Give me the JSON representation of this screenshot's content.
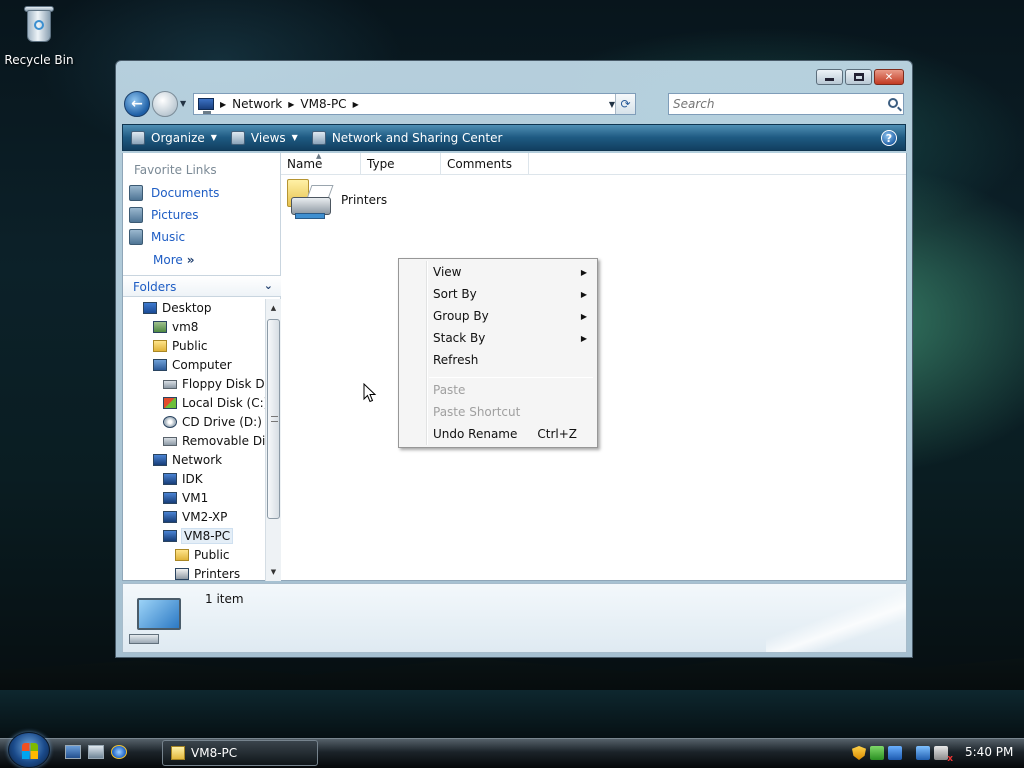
{
  "desktop": {
    "recycle_bin_label": "Recycle Bin"
  },
  "window": {
    "address": {
      "crumbs": [
        "Network",
        "VM8-PC"
      ]
    },
    "search": {
      "placeholder": "Search"
    },
    "toolbar": {
      "organize": "Organize",
      "views": "Views",
      "network_sharing": "Network and Sharing Center"
    },
    "favorite_links": {
      "title": "Favorite Links",
      "items": [
        "Documents",
        "Pictures",
        "Music"
      ],
      "more": "More",
      "more_chevron": "»"
    },
    "folders": {
      "title": "Folders",
      "tree": [
        "Desktop",
        "vm8",
        "Public",
        "Computer",
        "Floppy Disk Dr",
        "Local Disk (C:)",
        "CD Drive (D:)",
        "Removable Dis",
        "Network",
        "IDK",
        "VM1",
        "VM2-XP",
        "VM8-PC",
        "Public",
        "Printers"
      ]
    },
    "columns": [
      "Name",
      "Type",
      "Comments"
    ],
    "items": [
      {
        "label": "Printers",
        "icon": "printers-folder-icon"
      }
    ],
    "details": {
      "count": "1 item"
    }
  },
  "context_menu": {
    "items": [
      {
        "label": "View",
        "submenu": true,
        "enabled": true
      },
      {
        "label": "Sort By",
        "submenu": true,
        "enabled": true
      },
      {
        "label": "Group By",
        "submenu": true,
        "enabled": true
      },
      {
        "label": "Stack By",
        "submenu": true,
        "enabled": true
      },
      {
        "label": "Refresh",
        "submenu": false,
        "enabled": true
      },
      {
        "label": "Paste",
        "submenu": false,
        "enabled": false
      },
      {
        "label": "Paste Shortcut",
        "submenu": false,
        "enabled": false
      },
      {
        "label": "Undo Rename",
        "shortcut": "Ctrl+Z",
        "submenu": false,
        "enabled": true
      }
    ]
  },
  "taskbar": {
    "active_task": "VM8-PC",
    "clock": "5:40 PM"
  },
  "colors": {
    "link": "#1e5dc4",
    "toolbar": "#1e5a82",
    "disabled_text": "#a0a0a0"
  }
}
